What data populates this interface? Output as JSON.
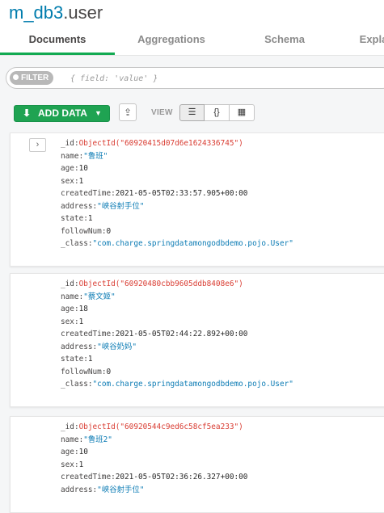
{
  "header": {
    "db": "m_db3",
    "collection": ".user"
  },
  "tabs": [
    {
      "label": "Documents",
      "active": true
    },
    {
      "label": "Aggregations"
    },
    {
      "label": "Schema"
    },
    {
      "label": "Expla"
    }
  ],
  "filter": {
    "badge": "FILTER",
    "placeholder": "{ field: 'value' }"
  },
  "toolbar": {
    "add_data_label": "ADD DATA",
    "view_label": "VIEW",
    "view_modes": [
      "list-icon",
      "json-icon",
      "table-icon"
    ]
  },
  "documents": [
    {
      "fields": [
        {
          "key": "_id",
          "value": "ObjectId(\"60920415d07d6e1624336745\")",
          "type": "oid"
        },
        {
          "key": "name",
          "value": "\"鲁班\"",
          "type": "str"
        },
        {
          "key": "age",
          "value": "10",
          "type": "num"
        },
        {
          "key": "sex",
          "value": "1",
          "type": "num"
        },
        {
          "key": "createdTime",
          "value": "2021-05-05T02:33:57.905+00:00",
          "type": "date"
        },
        {
          "key": "address",
          "value": "\"峡谷射手位\"",
          "type": "str"
        },
        {
          "key": "state",
          "value": "1",
          "type": "num"
        },
        {
          "key": "followNum",
          "value": "0",
          "type": "num"
        },
        {
          "key": "_class",
          "value": "\"com.charge.springdatamongodbdemo.pojo.User\"",
          "type": "str"
        }
      ]
    },
    {
      "fields": [
        {
          "key": "_id",
          "value": "ObjectId(\"60920480cbb9605ddb8408e6\")",
          "type": "oid"
        },
        {
          "key": "name",
          "value": "\"蔡文姬\"",
          "type": "str"
        },
        {
          "key": "age",
          "value": "18",
          "type": "num"
        },
        {
          "key": "sex",
          "value": "1",
          "type": "num"
        },
        {
          "key": "createdTime",
          "value": "2021-05-05T02:44:22.892+00:00",
          "type": "date"
        },
        {
          "key": "address",
          "value": "\"峡谷奶妈\"",
          "type": "str"
        },
        {
          "key": "state",
          "value": "1",
          "type": "num"
        },
        {
          "key": "followNum",
          "value": "0",
          "type": "num"
        },
        {
          "key": "_class",
          "value": "\"com.charge.springdatamongodbdemo.pojo.User\"",
          "type": "str"
        }
      ]
    },
    {
      "fields": [
        {
          "key": "_id",
          "value": "ObjectId(\"60920544c9ed6c58cf5ea233\")",
          "type": "oid"
        },
        {
          "key": "name",
          "value": "\"鲁班2\"",
          "type": "str"
        },
        {
          "key": "age",
          "value": "10",
          "type": "num"
        },
        {
          "key": "sex",
          "value": "1",
          "type": "num"
        },
        {
          "key": "createdTime",
          "value": "2021-05-05T02:36:26.327+00:00",
          "type": "date"
        },
        {
          "key": "address",
          "value": "\"峡谷射手位\"",
          "type": "str"
        }
      ]
    }
  ]
}
